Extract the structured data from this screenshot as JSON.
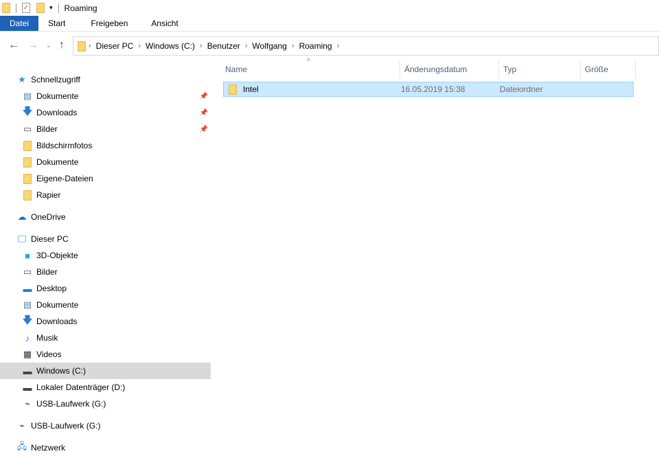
{
  "window": {
    "title": "Roaming"
  },
  "ribbon": {
    "tabs": [
      "Datei",
      "Start",
      "Freigeben",
      "Ansicht"
    ]
  },
  "breadcrumb": [
    "Dieser PC",
    "Windows (C:)",
    "Benutzer",
    "Wolfgang",
    "Roaming"
  ],
  "columns": [
    "Name",
    "Änderungsdatum",
    "Typ",
    "Größe"
  ],
  "files": [
    {
      "name": "Intel",
      "date": "16.05.2019 15:38",
      "type": "Dateiordner",
      "size": ""
    }
  ],
  "sidebar": {
    "items": [
      {
        "label": "Schnellzugriff",
        "icon": "star-icon"
      },
      {
        "label": "Dokumente",
        "icon": "document-icon",
        "pinned": true
      },
      {
        "label": "Downloads",
        "icon": "download-icon",
        "pinned": true
      },
      {
        "label": "Bilder",
        "icon": "pictures-icon",
        "pinned": true
      },
      {
        "label": "Bildschirmfotos",
        "icon": "folder-icon"
      },
      {
        "label": "Dokumente",
        "icon": "folder-icon"
      },
      {
        "label": "Eigene-Dateien",
        "icon": "folder-icon"
      },
      {
        "label": "Rapier",
        "icon": "folder-icon"
      },
      {
        "label": "OneDrive",
        "icon": "cloud-icon"
      },
      {
        "label": "Dieser PC",
        "icon": "computer-icon"
      },
      {
        "label": "3D-Objekte",
        "icon": "cube-icon"
      },
      {
        "label": "Bilder",
        "icon": "pictures-icon"
      },
      {
        "label": "Desktop",
        "icon": "desktop-icon"
      },
      {
        "label": "Dokumente",
        "icon": "document-icon"
      },
      {
        "label": "Downloads",
        "icon": "download-icon"
      },
      {
        "label": "Musik",
        "icon": "music-icon"
      },
      {
        "label": "Videos",
        "icon": "video-icon"
      },
      {
        "label": "Windows (C:)",
        "icon": "drive-icon",
        "selected": true
      },
      {
        "label": "Lokaler Datenträger (D:)",
        "icon": "drive-icon"
      },
      {
        "label": "USB-Laufwerk (G:)",
        "icon": "usb-icon"
      },
      {
        "label": "USB-Laufwerk (G:)",
        "icon": "usb-icon"
      },
      {
        "label": "Netzwerk",
        "icon": "network-icon"
      }
    ]
  }
}
